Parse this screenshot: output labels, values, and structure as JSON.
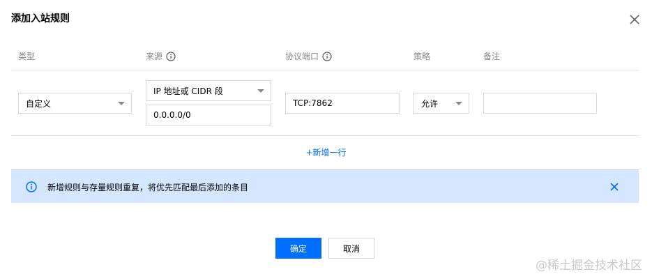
{
  "dialog": {
    "title": "添加入站规则"
  },
  "columns": {
    "type": "类型",
    "source": "来源",
    "port": "协议端口",
    "policy": "策略",
    "note": "备注"
  },
  "row": {
    "type_value": "自定义",
    "source_type": "IP 地址或 CIDR 段",
    "source_value": "0.0.0.0/0",
    "port_value": "TCP:7862",
    "policy_value": "允许",
    "note_value": ""
  },
  "add_row_label": "+新增一行",
  "alert": {
    "message": "新增规则与存量规则重复，将优先匹配最后添加的条目"
  },
  "buttons": {
    "confirm": "确定",
    "cancel": "取消"
  },
  "watermark": "@稀土掘金技术社区",
  "colors": {
    "primary": "#006eff",
    "alert_bg": "#d5e7ff",
    "muted_text": "#888888"
  }
}
